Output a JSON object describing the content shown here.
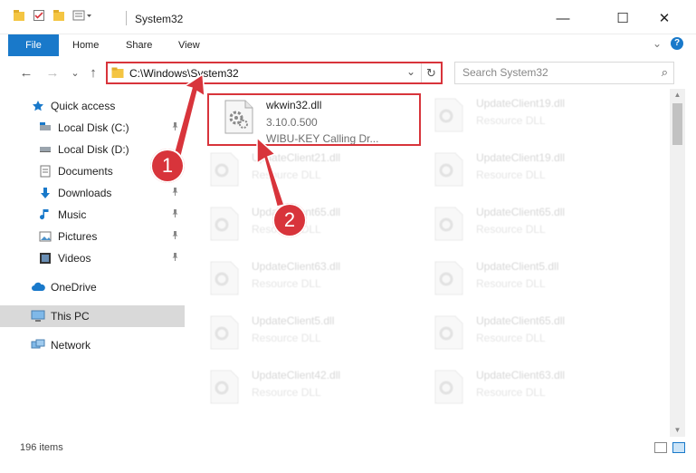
{
  "window": {
    "title": "System32",
    "minimize_glyph": "—",
    "maximize_glyph": "☐",
    "close_glyph": "✕"
  },
  "ribbon": {
    "tabs": [
      "File",
      "Home",
      "Share",
      "View"
    ],
    "help_glyph": "?",
    "expand_glyph": "⌄"
  },
  "address": {
    "path": "C:\\Windows\\System32",
    "back_glyph": "←",
    "forward_glyph": "→",
    "recent_glyph": "⌄",
    "up_glyph": "↑",
    "dropdown_glyph": "⌄",
    "refresh_glyph": "↻"
  },
  "search": {
    "placeholder": "Search System32",
    "icon_glyph": "⌕"
  },
  "nav": {
    "quick_access": "Quick access",
    "items": [
      {
        "label": "Local Disk (C:)",
        "icon": "disk-icon",
        "pinned": true
      },
      {
        "label": "Local Disk (D:)",
        "icon": "disk-icon",
        "pinned": false
      },
      {
        "label": "Documents",
        "icon": "documents-icon",
        "pinned": true
      },
      {
        "label": "Downloads",
        "icon": "downloads-icon",
        "pinned": true
      },
      {
        "label": "Music",
        "icon": "music-icon",
        "pinned": true
      },
      {
        "label": "Pictures",
        "icon": "pictures-icon",
        "pinned": true
      },
      {
        "label": "Videos",
        "icon": "videos-icon",
        "pinned": true
      }
    ],
    "onedrive": "OneDrive",
    "this_pc": "This PC",
    "network": "Network",
    "pin_glyph": "📌"
  },
  "files": {
    "highlighted": {
      "name": "wkwin32.dll",
      "version": "3.10.0.500",
      "description": "WIBU-KEY Calling Dr..."
    },
    "left_column": [
      {
        "name": "UpdateClient21.dll",
        "type": "Resource DLL"
      },
      {
        "name": "UpdateClient65.dll",
        "type": "Resource DLL"
      },
      {
        "name": "UpdateClient63.dll",
        "type": "Resource DLL"
      },
      {
        "name": "UpdateClient5.dll",
        "type": "Resource DLL"
      },
      {
        "name": "UpdateClient42.dll",
        "type": "Resource DLL"
      }
    ],
    "right_column": [
      {
        "name": "UpdateClient19.dll",
        "type": "Resource DLL"
      },
      {
        "name": "UpdateClient19.dll",
        "type": "Resource DLL"
      },
      {
        "name": "UpdateClient65.dll",
        "type": "Resource DLL"
      },
      {
        "name": "UpdateClient5.dll",
        "type": "Resource DLL"
      },
      {
        "name": "UpdateClient65.dll",
        "type": "Resource DLL"
      },
      {
        "name": "UpdateClient63.dll",
        "type": "Resource DLL"
      }
    ]
  },
  "status": {
    "count": "196 items"
  },
  "callouts": {
    "one": "1",
    "two": "2"
  },
  "colors": {
    "accent": "#1979ca",
    "callout_red": "#d8343b",
    "folder_yellow": "#f4c542"
  }
}
